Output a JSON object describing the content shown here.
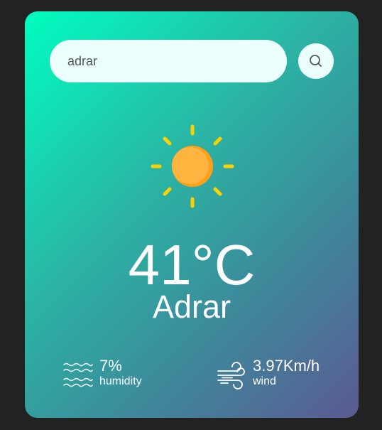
{
  "search": {
    "value": "adrar",
    "button_icon": "search-icon"
  },
  "weather": {
    "icon": "sun-icon",
    "temperature": "41°C",
    "city": "Adrar"
  },
  "details": {
    "humidity": {
      "icon": "humidity-waves-icon",
      "value": "7%",
      "label": "humidity"
    },
    "wind": {
      "icon": "wind-icon",
      "value": "3.97Km/h",
      "label": "wind"
    }
  },
  "colors": {
    "page_background": "#222222",
    "card_gradient_start": "#00fec0",
    "card_gradient_end": "#5b5a92",
    "input_background": "#ebfffc",
    "sun_body": "#ffb03b",
    "sun_rays": "#ffd000"
  }
}
